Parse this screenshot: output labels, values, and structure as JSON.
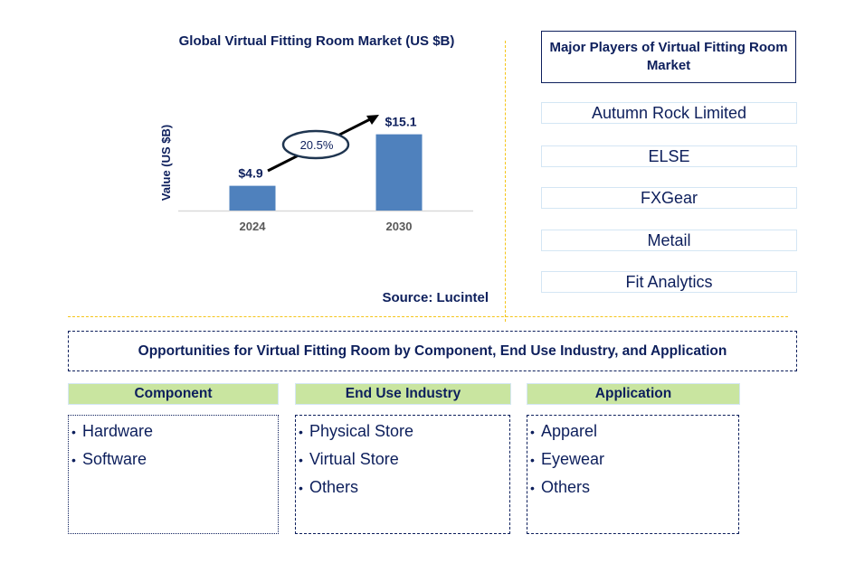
{
  "chart_data": {
    "type": "bar",
    "title": "Global Virtual Fitting Room Market (US $B)",
    "xlabel": "",
    "ylabel": "Value (US $B)",
    "categories": [
      "2024",
      "2030"
    ],
    "values": [
      4.9,
      15.1
    ],
    "data_labels": [
      "$4.9",
      "$15.1"
    ],
    "ylim": [
      0,
      17
    ],
    "grid": false,
    "bar_color": "#4f81bd",
    "annotation": {
      "type": "cagr-arrow",
      "label": "20.5%",
      "from": "2024",
      "to": "2030"
    },
    "source": "Source: Lucintel"
  },
  "players": {
    "title": "Major Players of Virtual Fitting Room Market",
    "items": [
      "Autumn Rock Limited",
      "ELSE",
      "FXGear",
      "Metail",
      "Fit Analytics"
    ]
  },
  "opportunities": {
    "title": "Opportunities for Virtual Fitting Room by Component, End Use Industry, and Application",
    "categories": [
      {
        "header": "Component",
        "items": [
          "Hardware",
          "Software"
        ]
      },
      {
        "header": "End Use Industry",
        "items": [
          "Physical Store",
          "Virtual Store",
          "Others"
        ]
      },
      {
        "header": "Application",
        "items": [
          "Apparel",
          "Eyewear",
          "Others"
        ]
      }
    ]
  },
  "colors": {
    "text": "#0d1f5c",
    "bar": "#4f81bd",
    "divider": "#f5c518",
    "category_header_bg": "#c9e5a0",
    "player_border": "#d4e6f4"
  }
}
